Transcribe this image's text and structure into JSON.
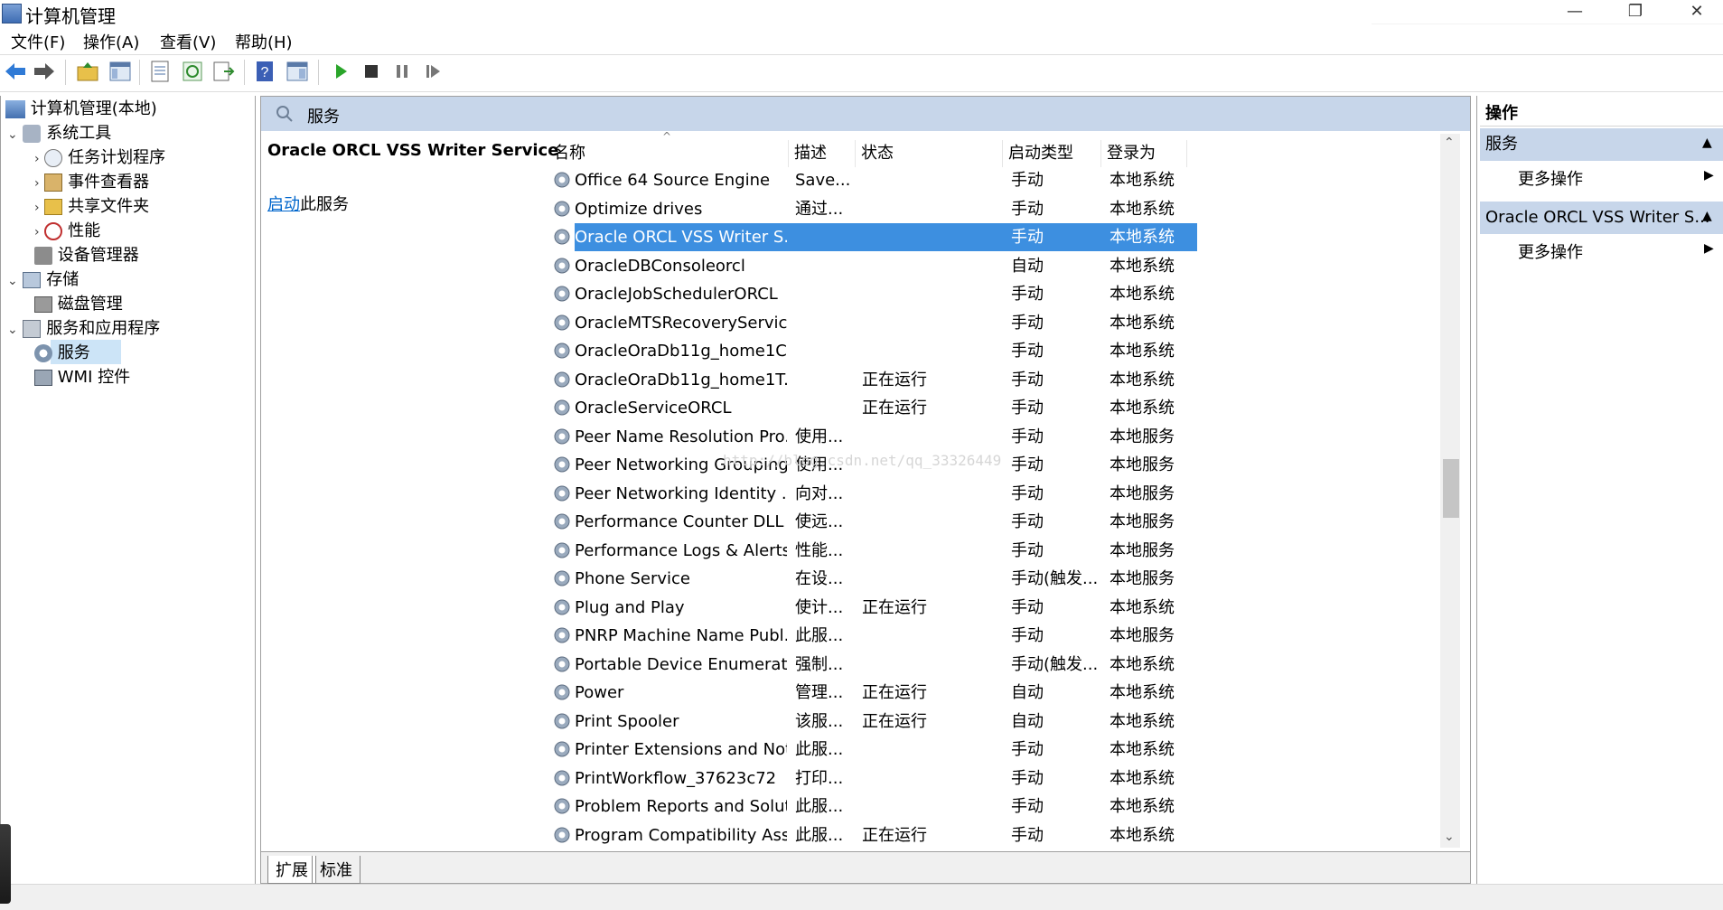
{
  "window": {
    "title": "计算机管理",
    "controls": [
      "—",
      "❐",
      "✕"
    ]
  },
  "menu": [
    "文件(F)",
    "操作(A)",
    "查看(V)",
    "帮助(H)"
  ],
  "tree": {
    "root": "计算机管理(本地)",
    "items": [
      {
        "label": "系统工具",
        "level": 1,
        "expanded": true
      },
      {
        "label": "任务计划程序",
        "level": 2,
        "expanded": false
      },
      {
        "label": "事件查看器",
        "level": 2,
        "expanded": false
      },
      {
        "label": "共享文件夹",
        "level": 2,
        "expanded": false
      },
      {
        "label": "性能",
        "level": 2,
        "expanded": false
      },
      {
        "label": "设备管理器",
        "level": 2
      },
      {
        "label": "存储",
        "level": 1,
        "expanded": true
      },
      {
        "label": "磁盘管理",
        "level": 2
      },
      {
        "label": "服务和应用程序",
        "level": 1,
        "expanded": true
      },
      {
        "label": "服务",
        "level": 2,
        "selected": true
      },
      {
        "label": "WMI 控件",
        "level": 2
      }
    ]
  },
  "center": {
    "header": "服务",
    "selected_service": "Oracle ORCL VSS Writer Service",
    "start_link": "启动",
    "start_suffix": "此服务",
    "columns": [
      "名称",
      "描述",
      "状态",
      "启动类型",
      "登录为"
    ],
    "rows": [
      {
        "name": "Office 64 Source Engine",
        "desc": "Save...",
        "status": "",
        "start": "手动",
        "logon": "本地系统"
      },
      {
        "name": "Optimize drives",
        "desc": "通过...",
        "status": "",
        "start": "手动",
        "logon": "本地系统"
      },
      {
        "name": "Oracle ORCL VSS Writer S...",
        "desc": "",
        "status": "",
        "start": "手动",
        "logon": "本地系统",
        "selected": true
      },
      {
        "name": "OracleDBConsoleorcl",
        "desc": "",
        "status": "",
        "start": "自动",
        "logon": "本地系统"
      },
      {
        "name": "OracleJobSchedulerORCL",
        "desc": "",
        "status": "",
        "start": "手动",
        "logon": "本地系统"
      },
      {
        "name": "OracleMTSRecoveryService",
        "desc": "",
        "status": "",
        "start": "手动",
        "logon": "本地系统"
      },
      {
        "name": "OracleOraDb11g_home1C...",
        "desc": "",
        "status": "",
        "start": "手动",
        "logon": "本地系统"
      },
      {
        "name": "OracleOraDb11g_home1T...",
        "desc": "",
        "status": "正在运行",
        "start": "手动",
        "logon": "本地系统"
      },
      {
        "name": "OracleServiceORCL",
        "desc": "",
        "status": "正在运行",
        "start": "手动",
        "logon": "本地系统"
      },
      {
        "name": "Peer Name Resolution Pro...",
        "desc": "使用...",
        "status": "",
        "start": "手动",
        "logon": "本地服务"
      },
      {
        "name": "Peer Networking Grouping",
        "desc": "使用...",
        "status": "",
        "start": "手动",
        "logon": "本地服务"
      },
      {
        "name": "Peer Networking Identity ...",
        "desc": "向对...",
        "status": "",
        "start": "手动",
        "logon": "本地服务"
      },
      {
        "name": "Performance Counter DLL ...",
        "desc": "使远...",
        "status": "",
        "start": "手动",
        "logon": "本地服务"
      },
      {
        "name": "Performance Logs & Alerts",
        "desc": "性能...",
        "status": "",
        "start": "手动",
        "logon": "本地服务"
      },
      {
        "name": "Phone Service",
        "desc": "在设...",
        "status": "",
        "start": "手动(触发...",
        "logon": "本地服务"
      },
      {
        "name": "Plug and Play",
        "desc": "使计...",
        "status": "正在运行",
        "start": "手动",
        "logon": "本地系统"
      },
      {
        "name": "PNRP Machine Name Publ...",
        "desc": "此服...",
        "status": "",
        "start": "手动",
        "logon": "本地服务"
      },
      {
        "name": "Portable Device Enumerat...",
        "desc": "强制...",
        "status": "",
        "start": "手动(触发...",
        "logon": "本地系统"
      },
      {
        "name": "Power",
        "desc": "管理...",
        "status": "正在运行",
        "start": "自动",
        "logon": "本地系统"
      },
      {
        "name": "Print Spooler",
        "desc": "该服...",
        "status": "正在运行",
        "start": "自动",
        "logon": "本地系统"
      },
      {
        "name": "Printer Extensions and Noti...",
        "desc": "此服...",
        "status": "",
        "start": "手动",
        "logon": "本地系统"
      },
      {
        "name": "PrintWorkflow_37623c72",
        "desc": "打印...",
        "status": "",
        "start": "手动",
        "logon": "本地系统"
      },
      {
        "name": "Problem Reports and Solut...",
        "desc": "此服...",
        "status": "",
        "start": "手动",
        "logon": "本地系统"
      },
      {
        "name": "Program Compatibility Assi...",
        "desc": "此服...",
        "status": "正在运行",
        "start": "手动",
        "logon": "本地系统"
      }
    ],
    "tabs": [
      "扩展",
      "标准"
    ],
    "watermark": "http://blog.csdn.net/qq_33326449"
  },
  "actions": {
    "header": "操作",
    "sections": [
      {
        "title": "服务",
        "item": "更多操作"
      },
      {
        "title": "Oracle ORCL VSS Writer S...",
        "item": "更多操作"
      }
    ]
  },
  "colors": {
    "selection": "#3d8fe0",
    "pane_header": "#c7d6ea",
    "link": "#0066cc"
  }
}
